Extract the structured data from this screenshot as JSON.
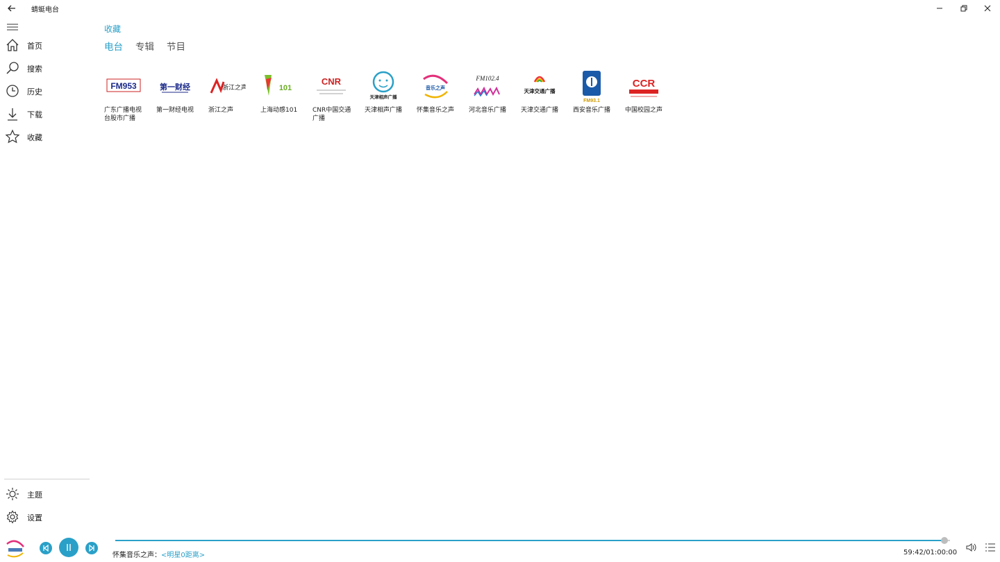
{
  "window": {
    "title": "蜻蜓电台"
  },
  "sidebar": {
    "items": [
      {
        "label": "首页",
        "icon": "home-icon"
      },
      {
        "label": "搜索",
        "icon": "search-icon"
      },
      {
        "label": "历史",
        "icon": "clock-icon"
      },
      {
        "label": "下载",
        "icon": "download-icon"
      },
      {
        "label": "收藏",
        "icon": "star-icon"
      }
    ],
    "bottom_items": [
      {
        "label": "主题",
        "icon": "sun-icon"
      },
      {
        "label": "设置",
        "icon": "gear-icon"
      }
    ]
  },
  "main": {
    "breadcrumb": "收藏",
    "tabs": [
      {
        "label": "电台",
        "active": true
      },
      {
        "label": "专辑",
        "active": false
      },
      {
        "label": "节目",
        "active": false
      }
    ],
    "stations": [
      {
        "name": "广东广播电视台股市广播",
        "logo_text": "FM953"
      },
      {
        "name": "第一财经电视",
        "logo_text": "第一财经"
      },
      {
        "name": "浙江之声",
        "logo_text": "浙江之声"
      },
      {
        "name": "上海动感101",
        "logo_text": "101"
      },
      {
        "name": "CNR中国交通广播",
        "logo_text": "CNR"
      },
      {
        "name": "天津相声广播",
        "logo_text": "天津相声广播"
      },
      {
        "name": "怀集音乐之声",
        "logo_text": "音乐之声"
      },
      {
        "name": "河北音乐广播",
        "logo_text": "FM102.4"
      },
      {
        "name": "天津交通广播",
        "logo_text": "天津交通广播"
      },
      {
        "name": "西安音乐广播",
        "logo_text": "FM93.1"
      },
      {
        "name": "中国校园之声",
        "logo_text": "CCR"
      }
    ]
  },
  "player": {
    "station": "怀集音乐之声：",
    "program": "<明星0距离>",
    "time": "59:42/01:00:00",
    "progress": 0.995
  },
  "colors": {
    "accent": "#2aa0c8"
  }
}
